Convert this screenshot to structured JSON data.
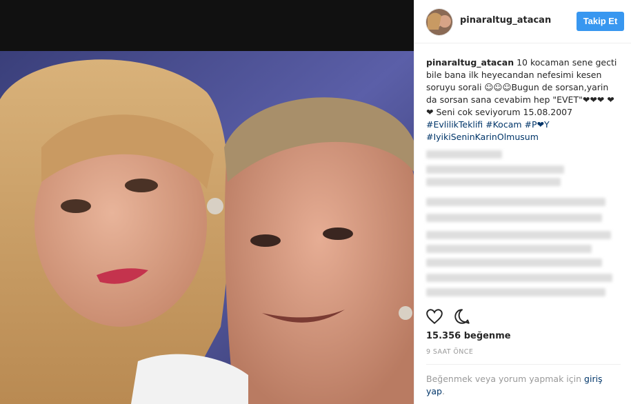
{
  "post": {
    "username": "pinaraltug_atacan",
    "follow_label": "Takip Et",
    "caption_username": "pinaraltug_atacan",
    "caption_text": "10 kocaman sene gecti bile bana ilk heyecandan nefesimi kesen soruyu sorali ☺☺☺Bugun de sorsan,yarin da sorsan sana cevabim hep \"EVET\"❤❤❤ ❤❤ Seni cok seviyorum 15.08.2007",
    "hashtags_line1": "#EvlilikTeklifi #Kocam #P❤Y",
    "hashtags_line2": "#IyikiSeninKarinOlmusum",
    "likes": "15.356 beğenme",
    "time": "9 SAAT ÖNCE",
    "login_prefix": "Beğenmek veya yorum yapmak için ",
    "login_link": "giriş yap",
    "login_suffix": "."
  },
  "icons": {
    "like": "heart-icon",
    "comment": "comment-icon"
  },
  "colors": {
    "follow_button": "#3897f0",
    "link": "#003569",
    "muted": "#999999"
  }
}
